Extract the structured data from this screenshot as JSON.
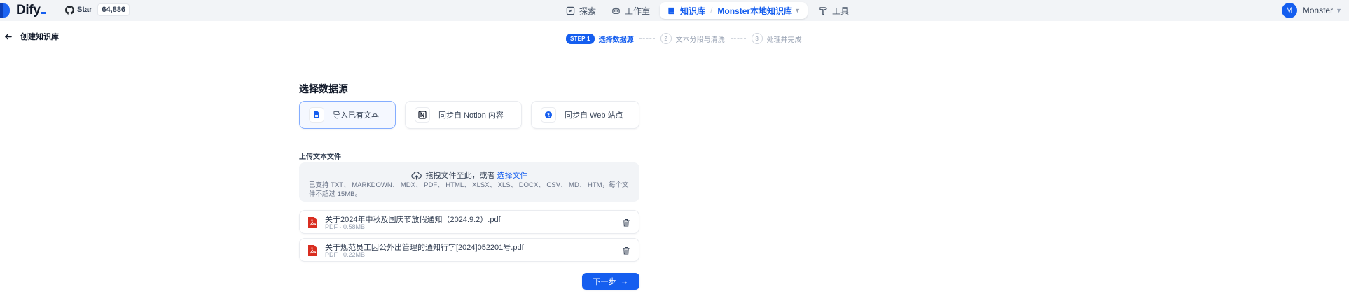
{
  "colors": {
    "accent": "#155eef",
    "topbar_bg": "#f2f4f7",
    "pdf_red": "#d92d20"
  },
  "header": {
    "logo_text": "Dify",
    "github": {
      "star_label": "Star",
      "star_count": "64,886"
    },
    "nav": [
      {
        "label": "探索",
        "icon": "compass-icon"
      },
      {
        "label": "工作室",
        "icon": "robot-icon"
      }
    ],
    "active_nav": {
      "label": "知识库",
      "dataset": "Monster本地知识库",
      "icon": "book-icon"
    },
    "tools": {
      "label": "工具",
      "icon": "hammer-icon"
    },
    "user": {
      "avatar_letter": "M",
      "name": "Monster"
    }
  },
  "subheader": {
    "back_label": "创建知识库",
    "steps": {
      "badge": "STEP 1",
      "step1_label": "选择数据源",
      "step2_num": "2",
      "step2_label": "文本分段与清洗",
      "step3_num": "3",
      "step3_label": "处理并完成"
    }
  },
  "main": {
    "section_title": "选择数据源",
    "sources": [
      {
        "label": "导入已有文本",
        "icon": "file-text-icon",
        "active": true
      },
      {
        "label": "同步自 Notion 内容",
        "icon": "notion-icon",
        "active": false
      },
      {
        "label": "同步自 Web 站点",
        "icon": "globe-icon",
        "active": false
      }
    ],
    "upload": {
      "title": "上传文本文件",
      "drop_text": "拖拽文件至此，或者",
      "select_link": "选择文件",
      "hint": "已支持 TXT、 MARKDOWN、 MDX、 PDF、 HTML、 XLSX、 XLS、 DOCX、 CSV、 MD、 HTM，每个文件不超过 15MB。"
    },
    "files": [
      {
        "name": "关于2024年中秋及国庆节放假通知（2024.9.2）.pdf",
        "meta": "PDF · 0.58MB"
      },
      {
        "name": "关于规范员工因公外出管理的通知行字[2024]052201号.pdf",
        "meta": "PDF · 0.22MB"
      }
    ],
    "next_label": "下一步"
  }
}
